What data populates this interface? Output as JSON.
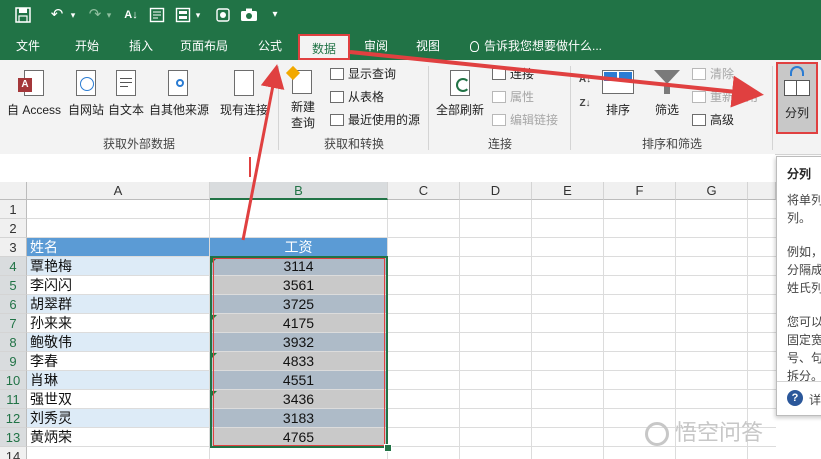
{
  "tabs": [
    "文件",
    "开始",
    "插入",
    "页面布局",
    "公式",
    "数据",
    "审阅",
    "视图"
  ],
  "tell_me": "告诉我您想要做什么...",
  "ribbon": {
    "get_external": {
      "from_access": "自 Access",
      "from_web": "自网站",
      "from_text": "自文本",
      "from_other": "自其他来源",
      "existing": "现有连接",
      "group": "获取外部数据"
    },
    "transform": {
      "new_query_l1": "新建",
      "new_query_l2": "查询",
      "show_queries": "显示查询",
      "from_table": "从表格",
      "recent_sources": "最近使用的源",
      "group": "获取和转换"
    },
    "connections": {
      "refresh_all": "全部刷新",
      "connections": "连接",
      "properties": "属性",
      "edit_links": "编辑链接",
      "group": "连接"
    },
    "sort_filter": {
      "sort": "排序",
      "filter": "筛选",
      "clear": "清除",
      "reapply": "重新应用",
      "advanced": "高级",
      "group": "排序和筛选"
    },
    "split": "分列"
  },
  "columns": [
    "A",
    "B",
    "C",
    "D",
    "E",
    "F",
    "G"
  ],
  "rows": [
    "1",
    "2",
    "3",
    "4",
    "5",
    "6",
    "7",
    "8",
    "9",
    "10",
    "11",
    "12",
    "13",
    "14"
  ],
  "table": {
    "header": [
      "姓名",
      "工资"
    ],
    "rows": [
      [
        "覃艳梅",
        "3114"
      ],
      [
        "李闪闪",
        "3561"
      ],
      [
        "胡翠群",
        "3725"
      ],
      [
        "孙来来",
        "4175"
      ],
      [
        "鲍敬伟",
        "3932"
      ],
      [
        "李春",
        "4833"
      ],
      [
        "肖琳",
        "4551"
      ],
      [
        "强世双",
        "3436"
      ],
      [
        "刘秀灵",
        "3183"
      ],
      [
        "黄炳荣",
        "4765"
      ]
    ]
  },
  "tooltip": {
    "title": "分列",
    "lines": [
      "将单列",
      "列。",
      "例如，",
      "分隔成",
      "姓氏列",
      "您可以",
      "固定宽",
      "号、句",
      "拆分。"
    ],
    "more": "详"
  },
  "watermark": "悟空问答",
  "colors": {
    "excel_green": "#217346",
    "header_blue": "#5b9bd5",
    "band_blue": "#ddebf7",
    "annotation_red": "#e04040"
  }
}
